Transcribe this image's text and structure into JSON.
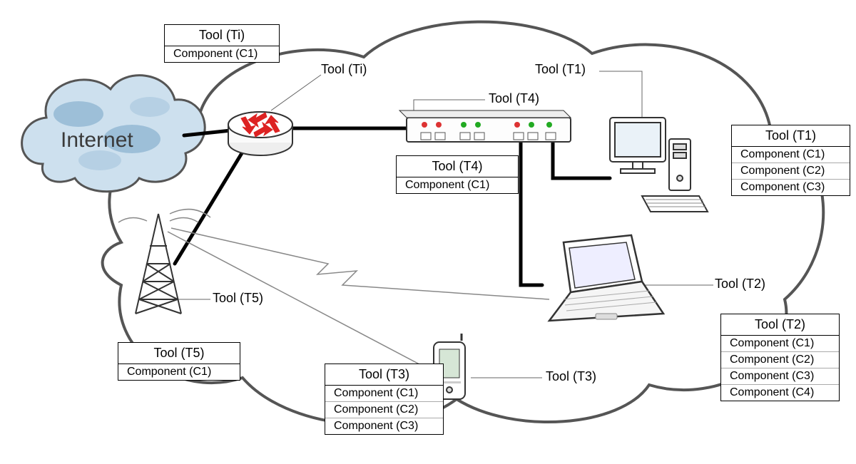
{
  "labels": {
    "internet": "Internet",
    "router_inline": "Tool (Ti)",
    "switch_inline": "Tool (T4)",
    "pc_inline": "Tool (T1)",
    "laptop_inline": "Tool (T2)",
    "phone_inline": "Tool (T3)",
    "tower_inline": "Tool (T5)"
  },
  "boxes": {
    "ti": {
      "title": "Tool (Ti)",
      "rows": [
        "Component (C1)"
      ]
    },
    "t4": {
      "title": "Tool (T4)",
      "rows": [
        "Component (C1)"
      ]
    },
    "t1": {
      "title": "Tool (T1)",
      "rows": [
        "Component (C1)",
        "Component (C2)",
        "Component (C3)"
      ]
    },
    "t2": {
      "title": "Tool (T2)",
      "rows": [
        "Component (C1)",
        "Component (C2)",
        "Component (C3)",
        "Component (C4)"
      ]
    },
    "t3": {
      "title": "Tool (T3)",
      "rows": [
        "Component (C1)",
        "Component (C2)",
        "Component (C3)"
      ]
    },
    "t5": {
      "title": "Tool (T5)",
      "rows": [
        "Component (C1)"
      ]
    }
  }
}
